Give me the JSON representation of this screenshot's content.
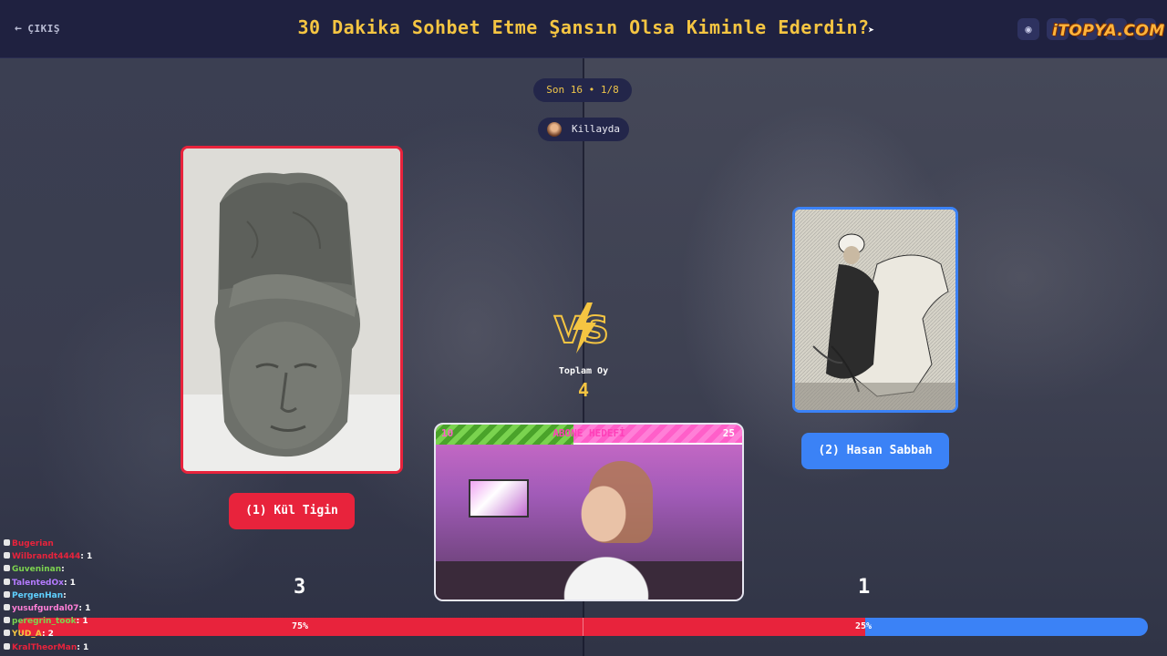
{
  "header": {
    "exit_label": "ÇIKIŞ",
    "title": "30 Dakika Sohbet Etme Şansın Olsa Kiminle Ederdin?",
    "logo": "iTOPYA.COM"
  },
  "round": {
    "label": "Son 16 • 1/8"
  },
  "user": {
    "name": "Killayda"
  },
  "left": {
    "button": "(1) Kül Tigin",
    "score": "3",
    "percent": "75%",
    "share": 0.75
  },
  "right": {
    "button": "(2) Hasan Sabbah",
    "score": "1",
    "percent": "25%",
    "share": 0.25
  },
  "center": {
    "total_label": "Toplam Oy",
    "total_value": "4",
    "vs": "VS"
  },
  "stream_goal": {
    "title": "ABONE HEDEFİ",
    "min": "10",
    "max": "25",
    "progress": 0.45
  },
  "chat": [
    {
      "name": "Bugerian",
      "value": "",
      "color": "#e8233c"
    },
    {
      "name": "Wilbrandt4444",
      "value": ": 1",
      "color": "#e8233c"
    },
    {
      "name": "Guveninan",
      "value": ":",
      "color": "#7cd34f"
    },
    {
      "name": "TalentedOx",
      "value": ": 1",
      "color": "#b57bff"
    },
    {
      "name": "PergenHan",
      "value": ":",
      "color": "#5fd0ff"
    },
    {
      "name": "yusufgurdal07",
      "value": ": 1",
      "color": "#ff7fd7"
    },
    {
      "name": "peregrin_took",
      "value": ": 1",
      "color": "#7cd34f"
    },
    {
      "name": "YUD_A",
      "value": ": 2",
      "color": "#f5c542"
    },
    {
      "name": "KralTheorMan",
      "value": ": 1",
      "color": "#e8233c"
    }
  ],
  "colors": {
    "accent_yellow": "#f5c542",
    "red": "#e8233c",
    "blue": "#3b82f6",
    "header": "#1f2140"
  }
}
